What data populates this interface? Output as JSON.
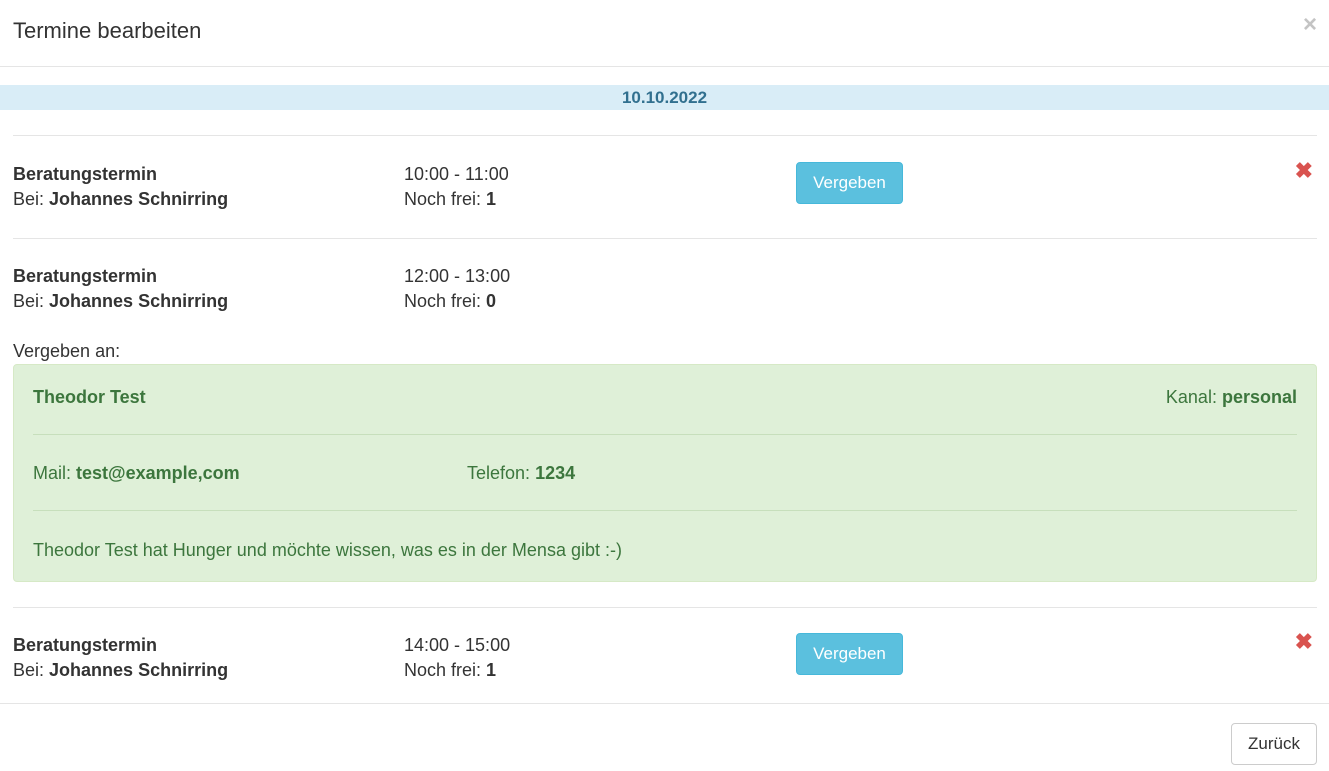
{
  "modal": {
    "title": "Termine bearbeiten",
    "close_symbol": "×"
  },
  "date": "10.10.2022",
  "labels": {
    "bei": "Bei:",
    "noch_frei": "Noch frei:",
    "assign_button": "Vergeben",
    "delete_symbol": "✖",
    "assigned_to": "Vergeben an:",
    "mail": "Mail:",
    "phone": "Telefon:",
    "channel": "Kanal:"
  },
  "slots": [
    {
      "title": "Beratungstermin",
      "advisor": "Johannes Schnirring",
      "time": "10:00 - 11:00",
      "free": "1"
    },
    {
      "title": "Beratungstermin",
      "advisor": "Johannes Schnirring",
      "time": "12:00 - 13:00",
      "free": "0"
    },
    {
      "title": "Beratungstermin",
      "advisor": "Johannes Schnirring",
      "time": "14:00 - 15:00",
      "free": "1"
    }
  ],
  "assignment": {
    "name": "Theodor Test",
    "channel": "personal",
    "mail": "test@example,com",
    "phone": "1234",
    "note": "Theodor Test hat Hunger und möchte wissen, was es in der Mensa gibt :-)"
  },
  "footer": {
    "back_label": "Zurück"
  },
  "colors": {
    "date_bar_bg": "#d9edf7",
    "date_bar_text": "#31708f",
    "info_button": "#5bc0de",
    "danger": "#d9534f",
    "success_bg": "#dff0d8",
    "success_text": "#3c763d"
  },
  "icons": {
    "header_close": "close-icon",
    "slot_delete": "delete-icon"
  }
}
